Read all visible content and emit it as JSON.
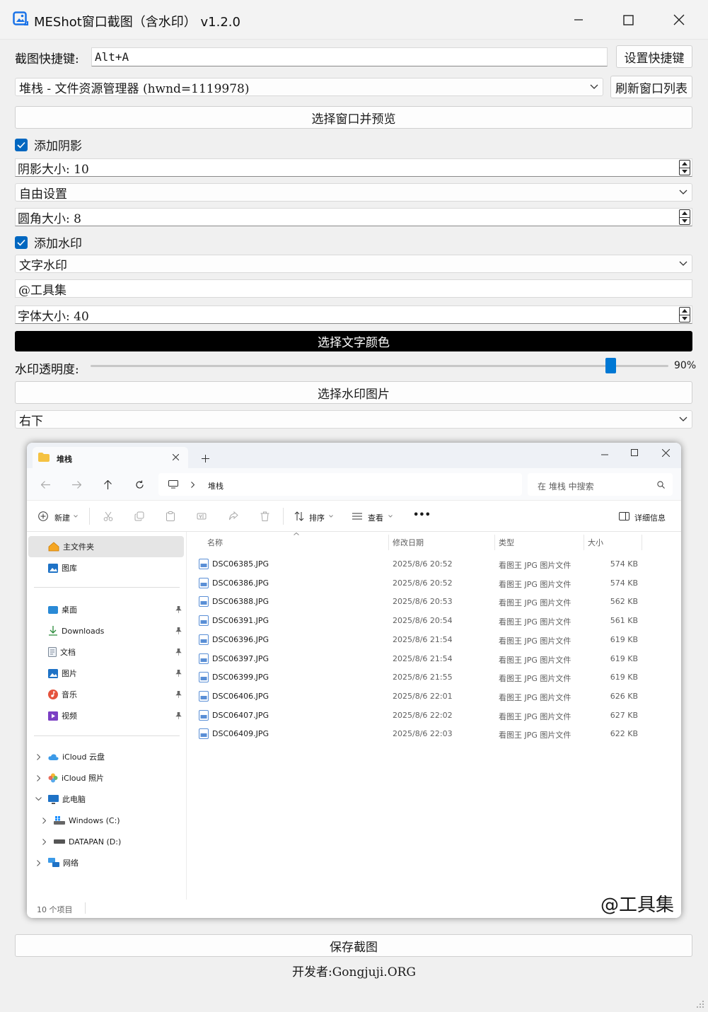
{
  "app": {
    "title": "MEShot窗口截图（含水印） v1.2.0",
    "accent": "#0078d4"
  },
  "hotkey": {
    "label": "截图快捷键:",
    "value": "Alt+A",
    "set_button": "设置快捷键"
  },
  "window_select": {
    "selected": "堆栈 - 文件资源管理器 (hwnd=1119978)",
    "refresh_button": "刷新窗口列表",
    "preview_button": "选择窗口并预览"
  },
  "shadow": {
    "checkbox_label": "添加阴影",
    "checked": true,
    "size_text": "阴影大小: 10",
    "mode": "自由设置",
    "radius_text": "圆角大小: 8"
  },
  "watermark": {
    "checkbox_label": "添加水印",
    "checked": true,
    "type": "文字水印",
    "text": "@工具集",
    "font_size_text": "字体大小: 40",
    "color_button": "选择文字颜色",
    "opacity_label": "水印透明度:",
    "opacity_value": "90%",
    "opacity_fraction": 0.9,
    "image_button": "选择水印图片",
    "position": "右下"
  },
  "preview": {
    "tab_title": "堆栈",
    "breadcrumb": "堆栈",
    "search_placeholder": "在 堆栈 中搜索",
    "toolbar": {
      "new_label": "新建",
      "sort_label": "排序",
      "view_label": "查看",
      "more_label": "•••",
      "details_label": "详细信息"
    },
    "sidebar": {
      "home": "主文件夹",
      "gallery": "图库",
      "pinned": [
        "桌面",
        "Downloads",
        "文档",
        "图片",
        "音乐",
        "视频"
      ],
      "icloud_drive": "iCloud 云盘",
      "icloud_photos": "iCloud 照片",
      "this_pc": "此电脑",
      "drive_c": "Windows (C:)",
      "drive_d": "DATAPAN (D:)",
      "network": "网络"
    },
    "columns": {
      "name": "名称",
      "date": "修改日期",
      "type": "类型",
      "size": "大小"
    },
    "files": [
      {
        "name": "DSC06385.JPG",
        "date": "2025/8/6 20:52",
        "type": "看图王 JPG 图片文件",
        "size": "574 KB"
      },
      {
        "name": "DSC06386.JPG",
        "date": "2025/8/6 20:52",
        "type": "看图王 JPG 图片文件",
        "size": "574 KB"
      },
      {
        "name": "DSC06388.JPG",
        "date": "2025/8/6 20:53",
        "type": "看图王 JPG 图片文件",
        "size": "562 KB"
      },
      {
        "name": "DSC06391.JPG",
        "date": "2025/8/6 20:54",
        "type": "看图王 JPG 图片文件",
        "size": "561 KB"
      },
      {
        "name": "DSC06396.JPG",
        "date": "2025/8/6 21:54",
        "type": "看图王 JPG 图片文件",
        "size": "619 KB"
      },
      {
        "name": "DSC06397.JPG",
        "date": "2025/8/6 21:54",
        "type": "看图王 JPG 图片文件",
        "size": "619 KB"
      },
      {
        "name": "DSC06399.JPG",
        "date": "2025/8/6 21:55",
        "type": "看图王 JPG 图片文件",
        "size": "619 KB"
      },
      {
        "name": "DSC06406.JPG",
        "date": "2025/8/6 22:01",
        "type": "看图王 JPG 图片文件",
        "size": "626 KB"
      },
      {
        "name": "DSC06407.JPG",
        "date": "2025/8/6 22:02",
        "type": "看图王 JPG 图片文件",
        "size": "627 KB"
      },
      {
        "name": "DSC06409.JPG",
        "date": "2025/8/6 22:03",
        "type": "看图王 JPG 图片文件",
        "size": "622 KB"
      }
    ],
    "status": "10 个项目",
    "watermark_text": "@工具集"
  },
  "save_button": "保存截图",
  "developer": "开发者:Gongjuji.ORG"
}
